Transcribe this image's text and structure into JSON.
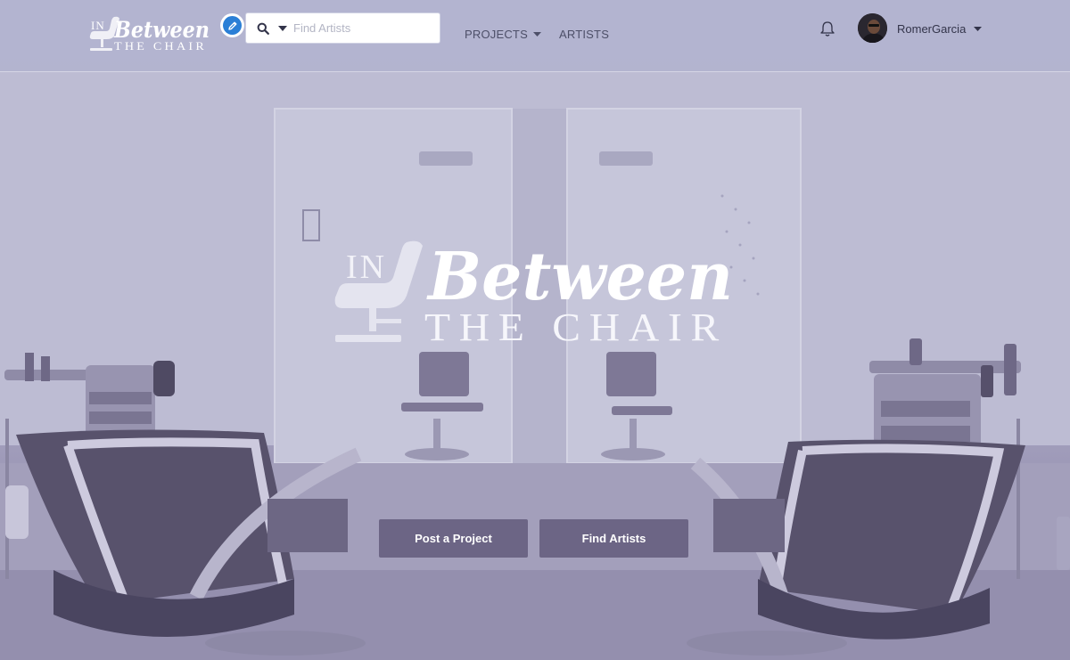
{
  "brand": {
    "logo_in": "IN",
    "logo_between": "Between",
    "logo_chair": "THE CHAIR"
  },
  "search": {
    "placeholder": "Find Artists",
    "icon": "search-icon",
    "dropdown_icon": "caret-down-icon"
  },
  "nav": {
    "projects_label": "PROJECTS",
    "artists_label": "ARTISTS"
  },
  "user": {
    "name": "RomerGarcia",
    "notifications_icon": "bell-icon"
  },
  "hero": {
    "logo_in": "IN",
    "logo_between": "Between",
    "logo_chair": "THE CHAIR"
  },
  "cta": {
    "post_project": "Post a Project",
    "find_artists": "Find Artists"
  },
  "colors": {
    "accent_blue": "#2b7fd6",
    "button_bg": "#6c6585",
    "nav_bg": "#b2b3cf"
  }
}
